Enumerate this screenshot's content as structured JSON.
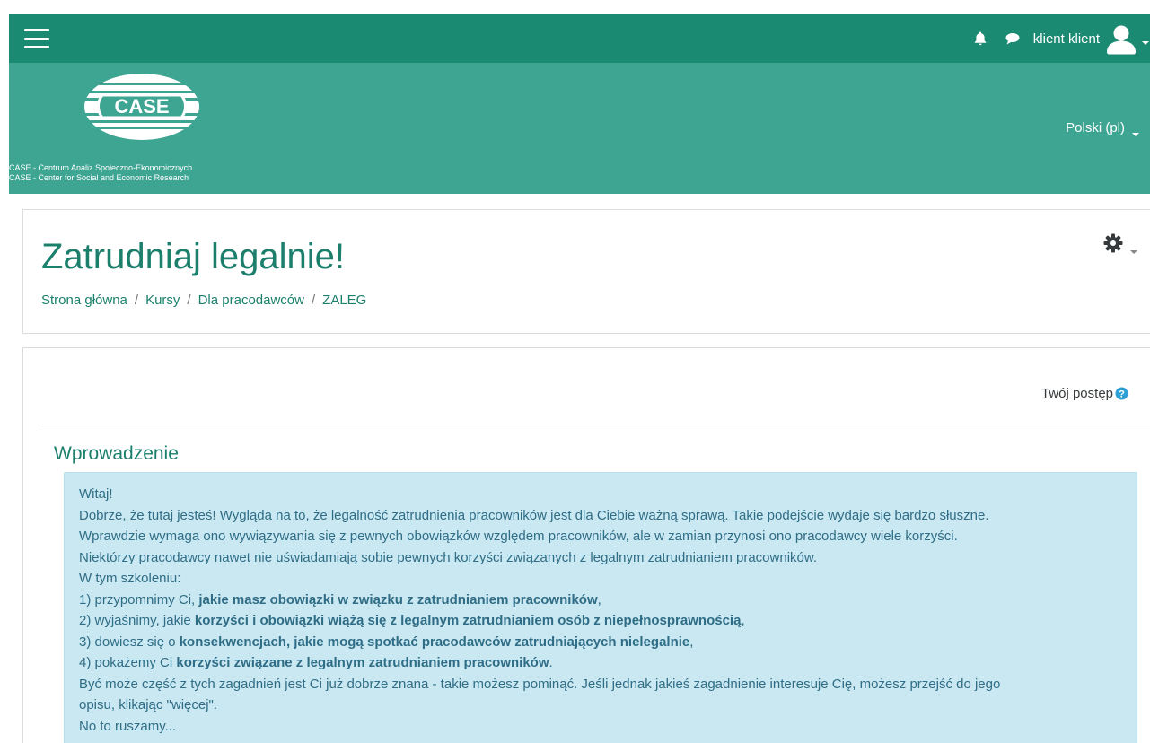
{
  "navbar": {
    "user_name": "klient klient"
  },
  "header": {
    "logo_text": "CASE",
    "org_line_pl": "CASE - Centrum Analiz Społeczno-Ekonomicznych",
    "org_line_en": "CASE - Center for Social and Economic Research",
    "language": "Polski (pl)"
  },
  "page": {
    "title": "Zatrudniaj legalnie!",
    "breadcrumb": [
      "Strona główna",
      "Kursy",
      "Dla pracodawców",
      "ZALEG"
    ],
    "breadcrumb_sep": "/"
  },
  "content": {
    "progress_label": "Twój postęp",
    "section_title": "Wprowadzenie",
    "intro": {
      "l1": "Witaj!",
      "l2": "Dobrze, że tutaj jesteś! Wygląda na to, że legalność zatrudnienia pracowników jest dla Ciebie ważną sprawą. Takie podejście wydaje się bardzo słuszne.",
      "l3": "Wprawdzie wymaga ono wywiązywania się z pewnych obowiązków względem pracowników, ale w zamian przynosi ono pracodawcy wiele korzyści.",
      "l4": "Niektórzy pracodawcy nawet nie uświadamiają sobie pewnych korzyści związanych z legalnym zatrudnianiem pracowników.",
      "l5": "W tym szkoleniu:",
      "l6a": "1) przypomnimy Ci, ",
      "l6b": "jakie masz obowiązki w związku z zatrudnianiem pracowników",
      "l6c": ",",
      "l7a": "2) wyjaśnimy, jakie ",
      "l7b": "korzyści i obowiązki wiążą się z legalnym zatrudnianiem osób z niepełnosprawnością",
      "l7c": ",",
      "l8a": "3) dowiesz się o ",
      "l8b": "konsekwencjach, jakie mogą spotkać pracodawców zatrudniających nielegalnie",
      "l8c": ",",
      "l9a": "4) pokażemy Ci ",
      "l9b": "korzyści związane z legalnym zatrudnianiem pracowników",
      "l9c": ".",
      "l10": "Być może część z tych zagadnień jest Ci już dobrze znana - takie możesz pominąć. Jeśli jednak jakieś zagadnienie interesuje Cię, możesz przejść do jego",
      "l11": "opisu, klikając \"więcej\".",
      "l12": "No to ruszamy..."
    }
  },
  "colors": {
    "navbar": "#1b8a73",
    "header_band": "#3fa593",
    "title": "#1b7f6c",
    "intro_bg": "#c9e8f2",
    "intro_text": "#2f6d86"
  },
  "icons": [
    "hamburger-icon",
    "bell-icon",
    "chat-icon",
    "user-avatar-icon",
    "gear-icon",
    "help-icon"
  ]
}
